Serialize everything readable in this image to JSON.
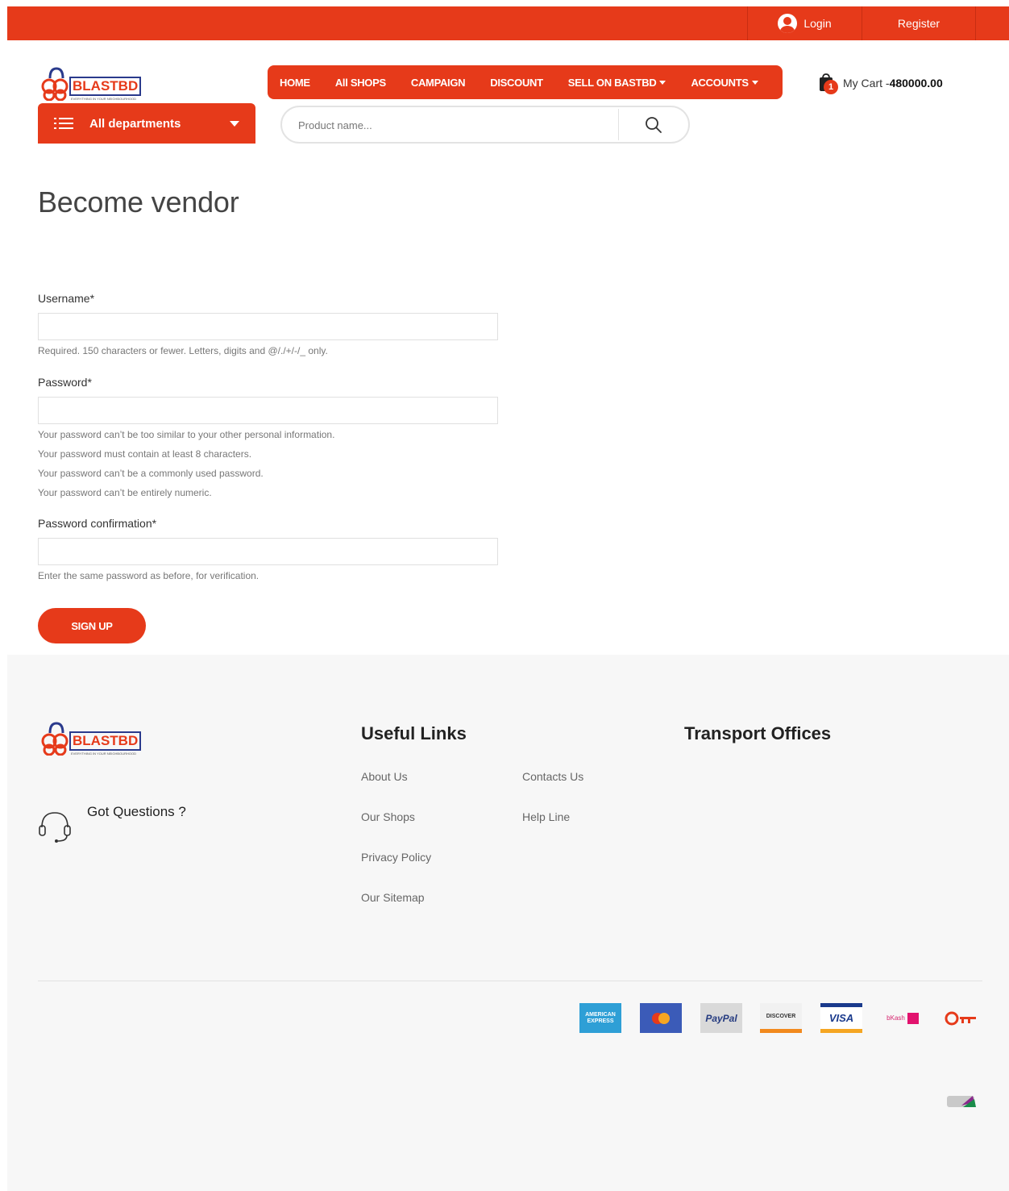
{
  "topbar": {
    "login_label": "Login",
    "register_label": "Register"
  },
  "logo": {
    "text": "BLASTBD",
    "tagline": "EVERYTHING IN YOUR NEIGHBOURHOOD"
  },
  "departments": {
    "label": "All departments"
  },
  "nav": {
    "items": [
      {
        "label": "HOME"
      },
      {
        "label": "All SHOPS"
      },
      {
        "label": "CAMPAIGN"
      },
      {
        "label": "DISCOUNT"
      },
      {
        "label": "SELL ON BASTBD"
      },
      {
        "label": "ACCOUNTS"
      }
    ]
  },
  "search": {
    "placeholder": "Product name..."
  },
  "cart": {
    "badge": "1",
    "label": "My Cart -",
    "amount": "480000.00"
  },
  "page": {
    "title": "Become vendor"
  },
  "form": {
    "username_label": "Username*",
    "username_help": "Required. 150 characters or fewer. Letters, digits and @/./+/-/_ only.",
    "password_label": "Password*",
    "password_help": [
      "Your password can’t be too similar to your other personal information.",
      "Your password must contain at least 8 characters.",
      "Your password can’t be a commonly used password.",
      "Your password can’t be entirely numeric."
    ],
    "confirm_label": "Password confirmation*",
    "confirm_help": "Enter the same password as before, for verification.",
    "submit_label": "SIGN UP"
  },
  "footer": {
    "got_questions": "Got Questions ?",
    "useful_links_title": "Useful Links",
    "transport_title": "Transport Offices",
    "links_col1": [
      "About Us",
      "Our Shops",
      "Privacy Policy",
      "Our Sitemap"
    ],
    "links_col2": [
      "Contacts Us",
      "Help Line"
    ],
    "payments": {
      "amex": "AMERICAN EXPRESS",
      "paypal": "PayPal",
      "discover": "DISCOVER",
      "visa": "VISA",
      "bkash": "bKash"
    }
  },
  "colors": {
    "brand": "#e63a1a",
    "footer_bg": "#f7f7f7"
  }
}
